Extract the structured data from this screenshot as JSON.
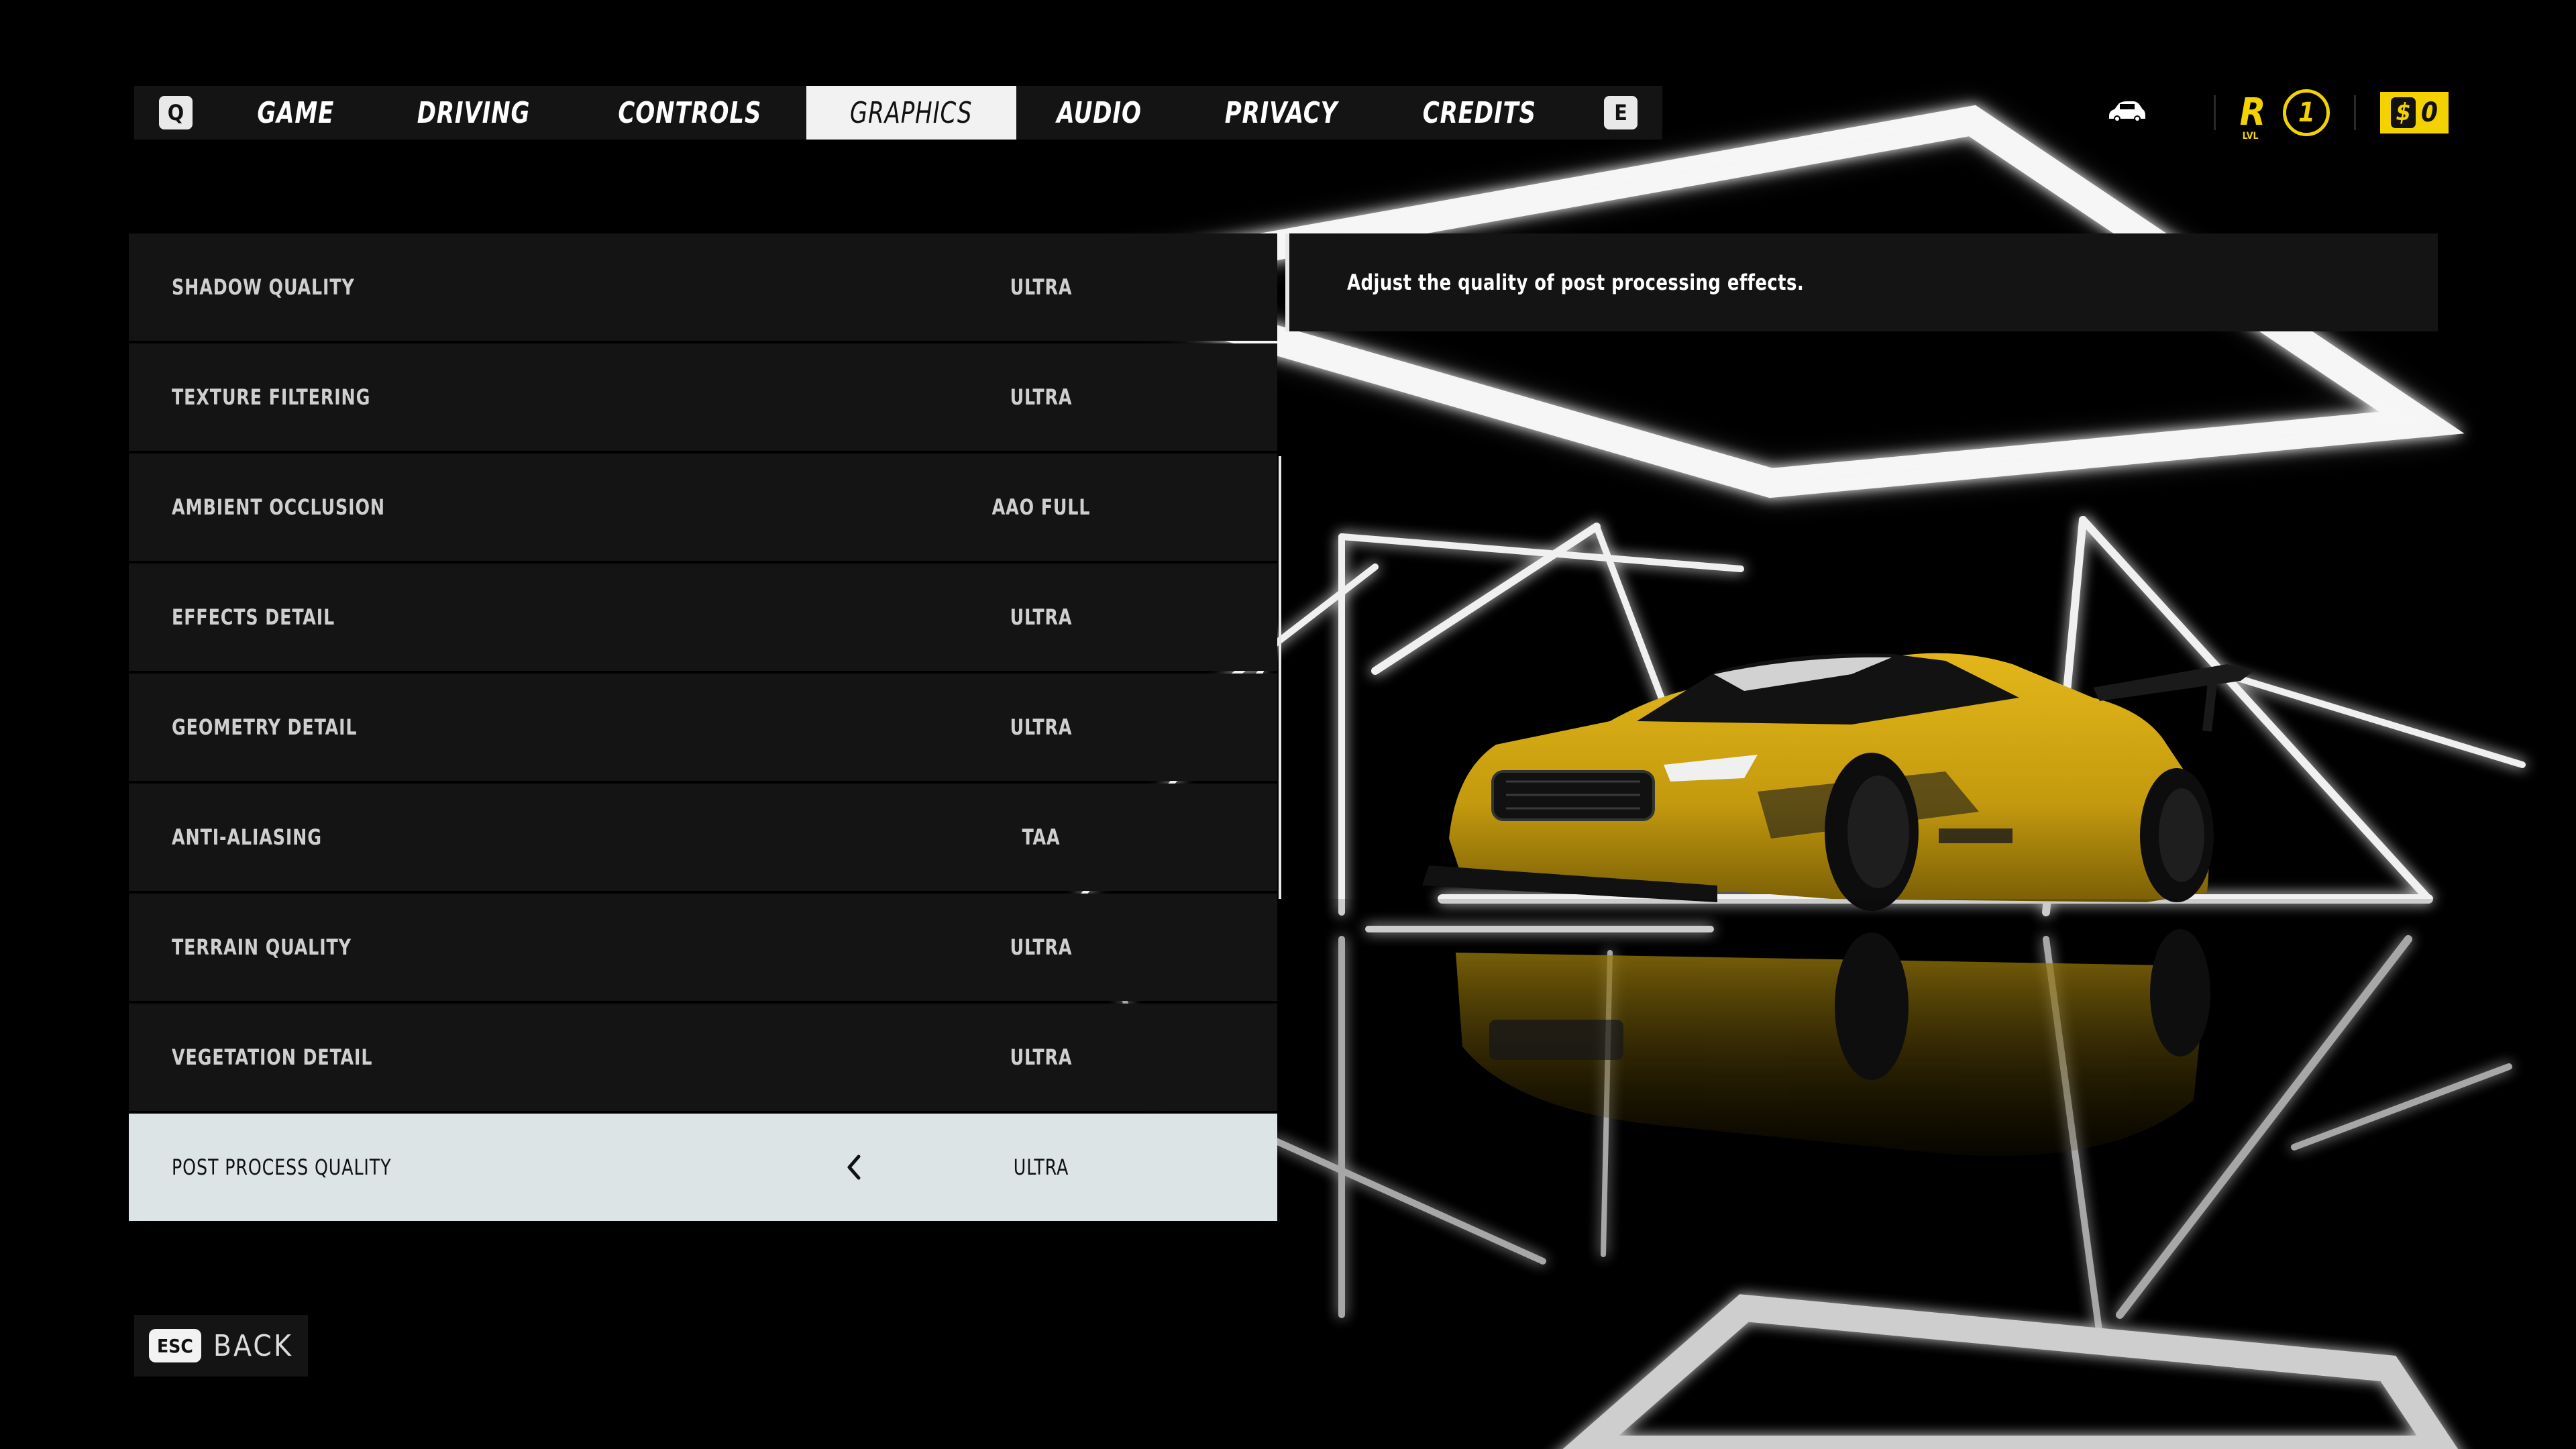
{
  "tabs": {
    "left_key": "Q",
    "right_key": "E",
    "items": [
      {
        "label": "GAME"
      },
      {
        "label": "DRIVING"
      },
      {
        "label": "CONTROLS"
      },
      {
        "label": "GRAPHICS"
      },
      {
        "label": "AUDIO"
      },
      {
        "label": "PRIVACY"
      },
      {
        "label": "CREDITS"
      }
    ],
    "active": "GRAPHICS"
  },
  "hud": {
    "garage_icon": "car-icon",
    "rep_letter": "R",
    "rep_sub": "LVL",
    "rep_level": "1",
    "money_symbol": "$",
    "money_value": "0",
    "accent_color": "#f3d200"
  },
  "settings": [
    {
      "label": "SHADOW QUALITY",
      "value": "ULTRA"
    },
    {
      "label": "TEXTURE FILTERING",
      "value": "ULTRA"
    },
    {
      "label": "AMBIENT OCCLUSION",
      "value": "AAO FULL"
    },
    {
      "label": "EFFECTS DETAIL",
      "value": "ULTRA"
    },
    {
      "label": "GEOMETRY DETAIL",
      "value": "ULTRA"
    },
    {
      "label": "ANTI-ALIASING",
      "value": "TAA"
    },
    {
      "label": "TERRAIN QUALITY",
      "value": "ULTRA"
    },
    {
      "label": "VEGETATION DETAIL",
      "value": "ULTRA"
    },
    {
      "label": "POST PROCESS QUALITY",
      "value": "ULTRA",
      "selected": true
    }
  ],
  "description": "Adjust the quality of post processing effects.",
  "back": {
    "key": "ESC",
    "label": "BACK"
  },
  "colors": {
    "panel": "#141414",
    "selected_row": "#dde4e6",
    "car_yellow": "#c9a012"
  }
}
